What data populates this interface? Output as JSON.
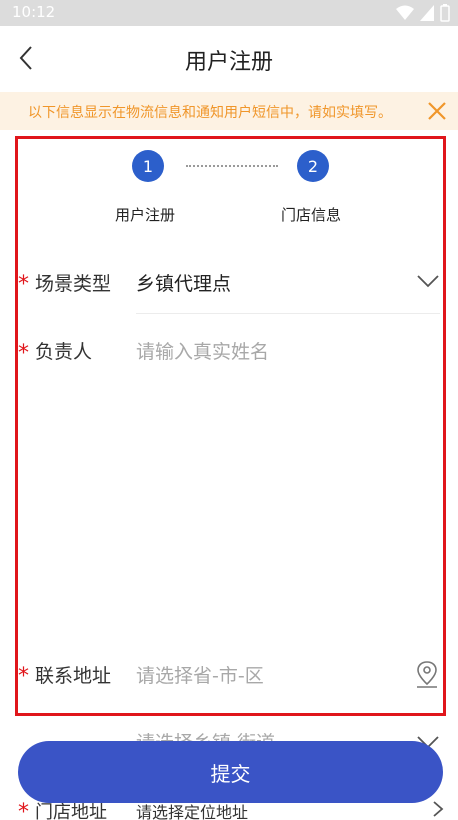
{
  "status": {
    "time": "10:12"
  },
  "header": {
    "title": "用户注册"
  },
  "notice": {
    "text": "以下信息显示在物流信息和通知用户短信中，请如实填写。"
  },
  "steps": [
    {
      "number": "1",
      "label": "用户注册"
    },
    {
      "number": "2",
      "label": "门店信息"
    }
  ],
  "form": {
    "scene_type": {
      "label": "场景类型",
      "value": "乡镇代理点"
    },
    "manager": {
      "label": "负责人",
      "placeholder": "请输入真实姓名"
    },
    "contact_address": {
      "label": "联系地址",
      "placeholder": "请选择省-市-区"
    },
    "town_street": {
      "placeholder": "请选择乡镇,街道"
    },
    "store_address": {
      "label": "门店地址",
      "placeholder": "请选择定位地址"
    }
  },
  "submit": {
    "label": "提交"
  },
  "colors": {
    "accent": "#3a54c6",
    "step": "#2c5fcb",
    "required": "#e0161b",
    "notice_text": "#f0962a",
    "notice_bg": "#fdf2e3"
  }
}
